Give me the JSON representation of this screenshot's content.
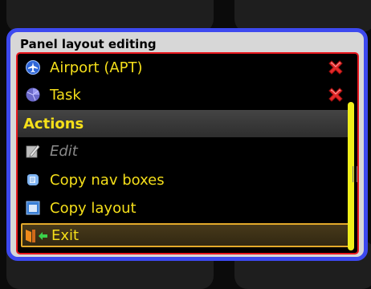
{
  "dialog": {
    "title": "Panel layout editing"
  },
  "items": {
    "airport": {
      "label": "Airport (APT)",
      "icon": "airport-icon"
    },
    "task": {
      "label": "Task",
      "icon": "task-icon"
    }
  },
  "actions": {
    "heading": "Actions",
    "edit": {
      "label": "Edit",
      "icon": "pencil-icon",
      "disabled": true
    },
    "copy_nav": {
      "label": "Copy nav boxes",
      "icon": "copy-icon"
    },
    "copy_layout": {
      "label": "Copy layout",
      "icon": "layout-icon"
    },
    "exit": {
      "label": "Exit",
      "icon": "exit-icon",
      "selected": true
    }
  },
  "colors": {
    "label_text": "#f5df1a",
    "dialog_border": "#3d49ef",
    "panel_border": "#e8181e",
    "delete": "#e42a2a",
    "selected_border": "#e3a92b"
  }
}
